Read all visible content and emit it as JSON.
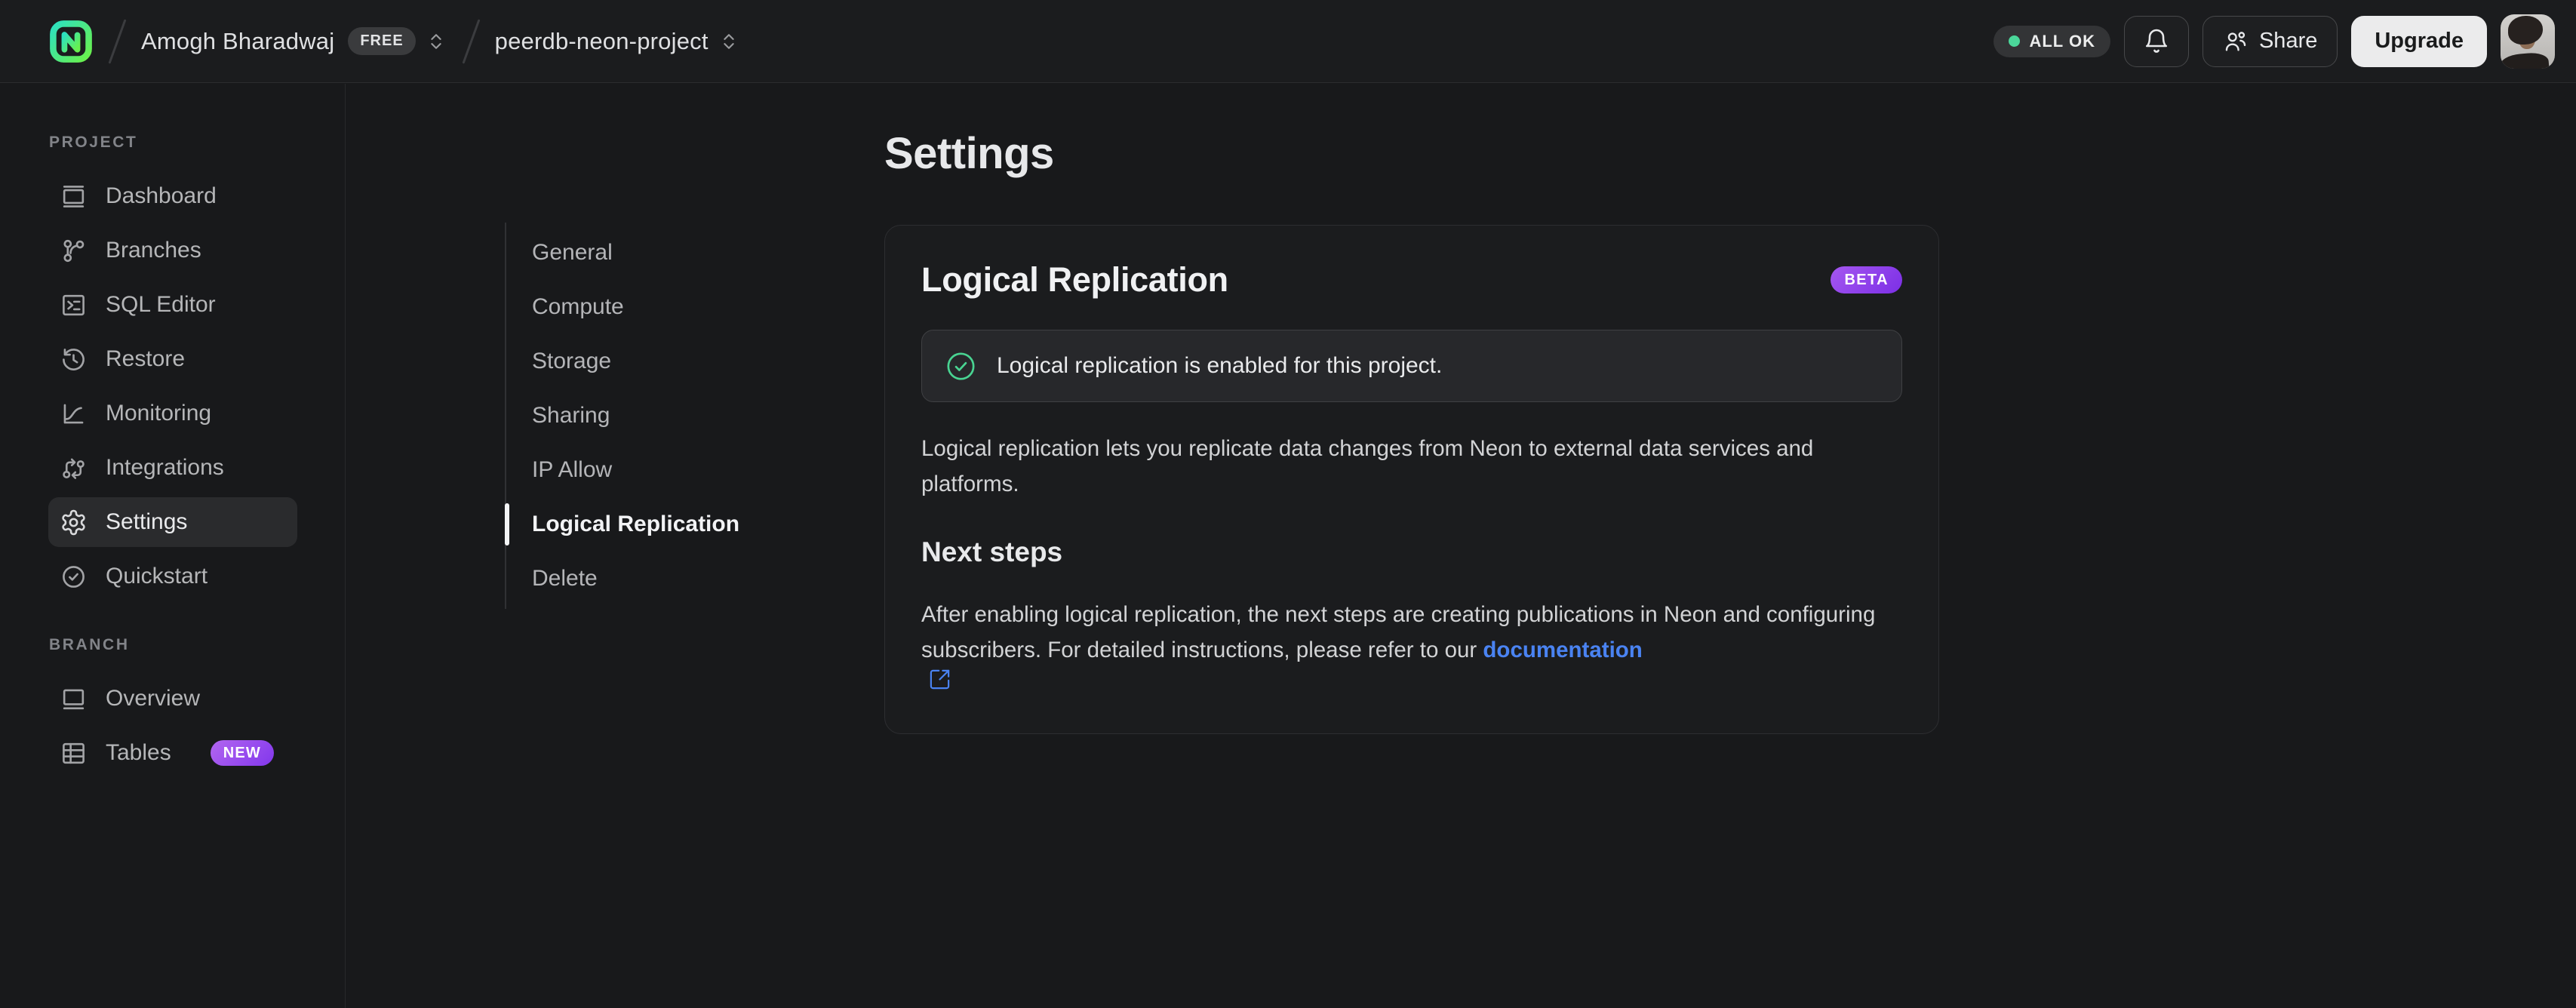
{
  "topbar": {
    "breadcrumb": {
      "org_name": "Amogh Bharadwaj",
      "plan_badge": "FREE",
      "project_name": "peerdb-neon-project"
    },
    "status_badge": "ALL OK",
    "share_label": "Share",
    "upgrade_label": "Upgrade",
    "icons": [
      "neon-logo",
      "chevron-up-down-icon",
      "bell-icon",
      "users-icon",
      "avatar"
    ]
  },
  "sidebar": {
    "project_section_label": "PROJECT",
    "project_items": [
      {
        "label": "Dashboard",
        "icon": "dashboard-icon",
        "active": false
      },
      {
        "label": "Branches",
        "icon": "git-branch-icon",
        "active": false
      },
      {
        "label": "SQL Editor",
        "icon": "terminal-icon",
        "active": false
      },
      {
        "label": "Restore",
        "icon": "history-icon",
        "active": false
      },
      {
        "label": "Monitoring",
        "icon": "chart-icon",
        "active": false
      },
      {
        "label": "Integrations",
        "icon": "integrations-icon",
        "active": false
      },
      {
        "label": "Settings",
        "icon": "gear-icon",
        "active": true
      },
      {
        "label": "Quickstart",
        "icon": "check-circle-icon",
        "active": false
      }
    ],
    "branch_section_label": "BRANCH",
    "branch_items": [
      {
        "label": "Overview",
        "icon": "window-icon",
        "badge": ""
      },
      {
        "label": "Tables",
        "icon": "table-icon",
        "badge": "NEW"
      }
    ]
  },
  "settings_nav": {
    "items": [
      {
        "label": "General",
        "active": false
      },
      {
        "label": "Compute",
        "active": false
      },
      {
        "label": "Storage",
        "active": false
      },
      {
        "label": "Sharing",
        "active": false
      },
      {
        "label": "IP Allow",
        "active": false
      },
      {
        "label": "Logical Replication",
        "active": true
      },
      {
        "label": "Delete",
        "active": false
      }
    ]
  },
  "main": {
    "page_title": "Settings",
    "card": {
      "title": "Logical Replication",
      "beta_badge": "BETA",
      "success_message": "Logical replication is enabled for this project.",
      "description": "Logical replication lets you replicate data changes from Neon to external data services and platforms.",
      "next_steps_title": "Next steps",
      "next_steps_text": "After enabling logical replication, the next steps are creating publications in Neon and configuring subscribers. For detailed instructions, please refer to our ",
      "doc_link_label": "documentation",
      "doc_link_icon": "external-link-icon"
    }
  },
  "colors": {
    "page_bg": "#18191b",
    "topbar_bg": "#1b1c1e",
    "card_bg": "#1b1c1e",
    "banner_bg": "#27282b",
    "border": "#2d2e31",
    "accent_green": "#4bd79a",
    "success_icon_green": "#49d492",
    "badge_purple_from": "#b266f0",
    "badge_purple_to": "#8237ec",
    "link_blue": "#4a83f2",
    "logo_gradient_from": "#2de0c0",
    "logo_gradient_to": "#68f04f",
    "upgrade_btn_bg": "#ebebec"
  }
}
